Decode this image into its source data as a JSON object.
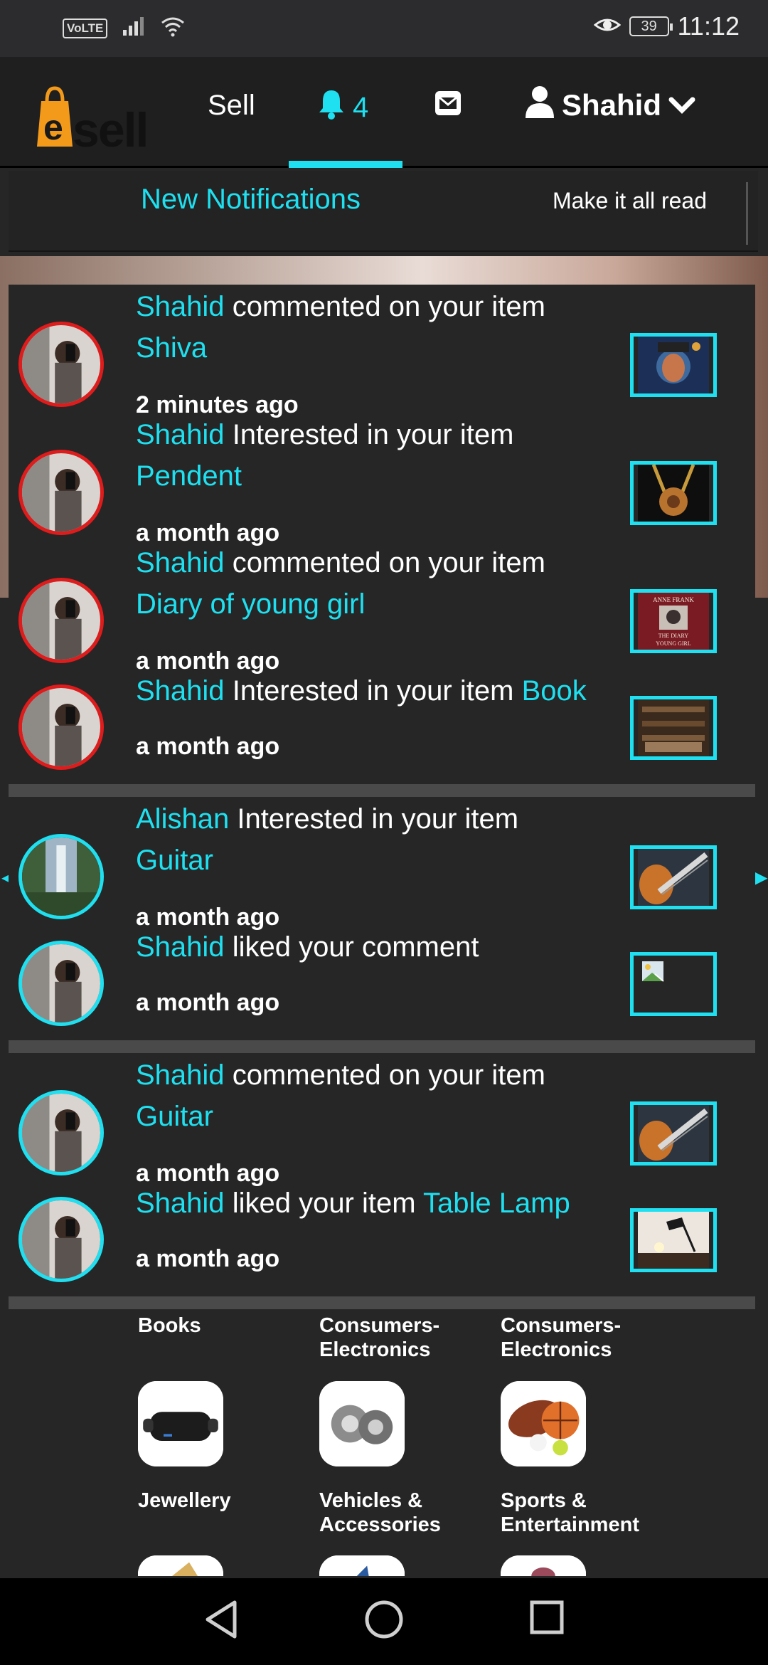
{
  "status": {
    "network": "VoLTE",
    "battery": "39",
    "time": "11:12"
  },
  "nav": {
    "sell": "Sell",
    "notif_count": "4",
    "user": "Shahid"
  },
  "header": {
    "title": "New Notifications",
    "mark_read": "Make it all read"
  },
  "notifications": [
    {
      "actor": "Shahid",
      "action": "commented on your item",
      "item": "Shiva",
      "time": "2 minutes ago",
      "ring": "red"
    },
    {
      "actor": "Shahid",
      "action": "Interested in your item",
      "item": "Pendent",
      "time": "a month ago",
      "ring": "red"
    },
    {
      "actor": "Shahid",
      "action": "commented on your item",
      "item": "Diary of young girl",
      "time": "a month ago",
      "ring": "red"
    },
    {
      "actor": "Shahid",
      "action": "Interested in your item",
      "item": "Book",
      "time": "a month ago",
      "ring": "red"
    },
    {
      "actor": "Alishan",
      "action": "Interested in your item",
      "item": "Guitar",
      "time": "a month ago",
      "ring": "cyan"
    },
    {
      "actor": "Shahid",
      "action": "liked your comment",
      "item": "",
      "time": "a month ago",
      "ring": "cyan"
    },
    {
      "actor": "Shahid",
      "action": "commented on your item",
      "item": "Guitar",
      "time": "a month ago",
      "ring": "cyan"
    },
    {
      "actor": "Shahid",
      "action": "liked your item",
      "item": "Table Lamp",
      "time": "a month ago",
      "ring": "cyan"
    }
  ],
  "thumb_texts": {
    "book_title_top": "ANNE FRANK",
    "book_title_bottom": "THE DIARY",
    "book_title_sub": "YOUNG GIRL"
  },
  "categories_row1": [
    "Books",
    "Consumers-Electronics",
    "Consumers-Electronics"
  ],
  "categories_row2": [
    "Jewellery",
    "Vehicles & Accessories",
    "Sports & Entertainment"
  ],
  "colors": {
    "accent": "#1ee0f0",
    "unread_ring": "#e01b1b",
    "background": "#262626"
  }
}
